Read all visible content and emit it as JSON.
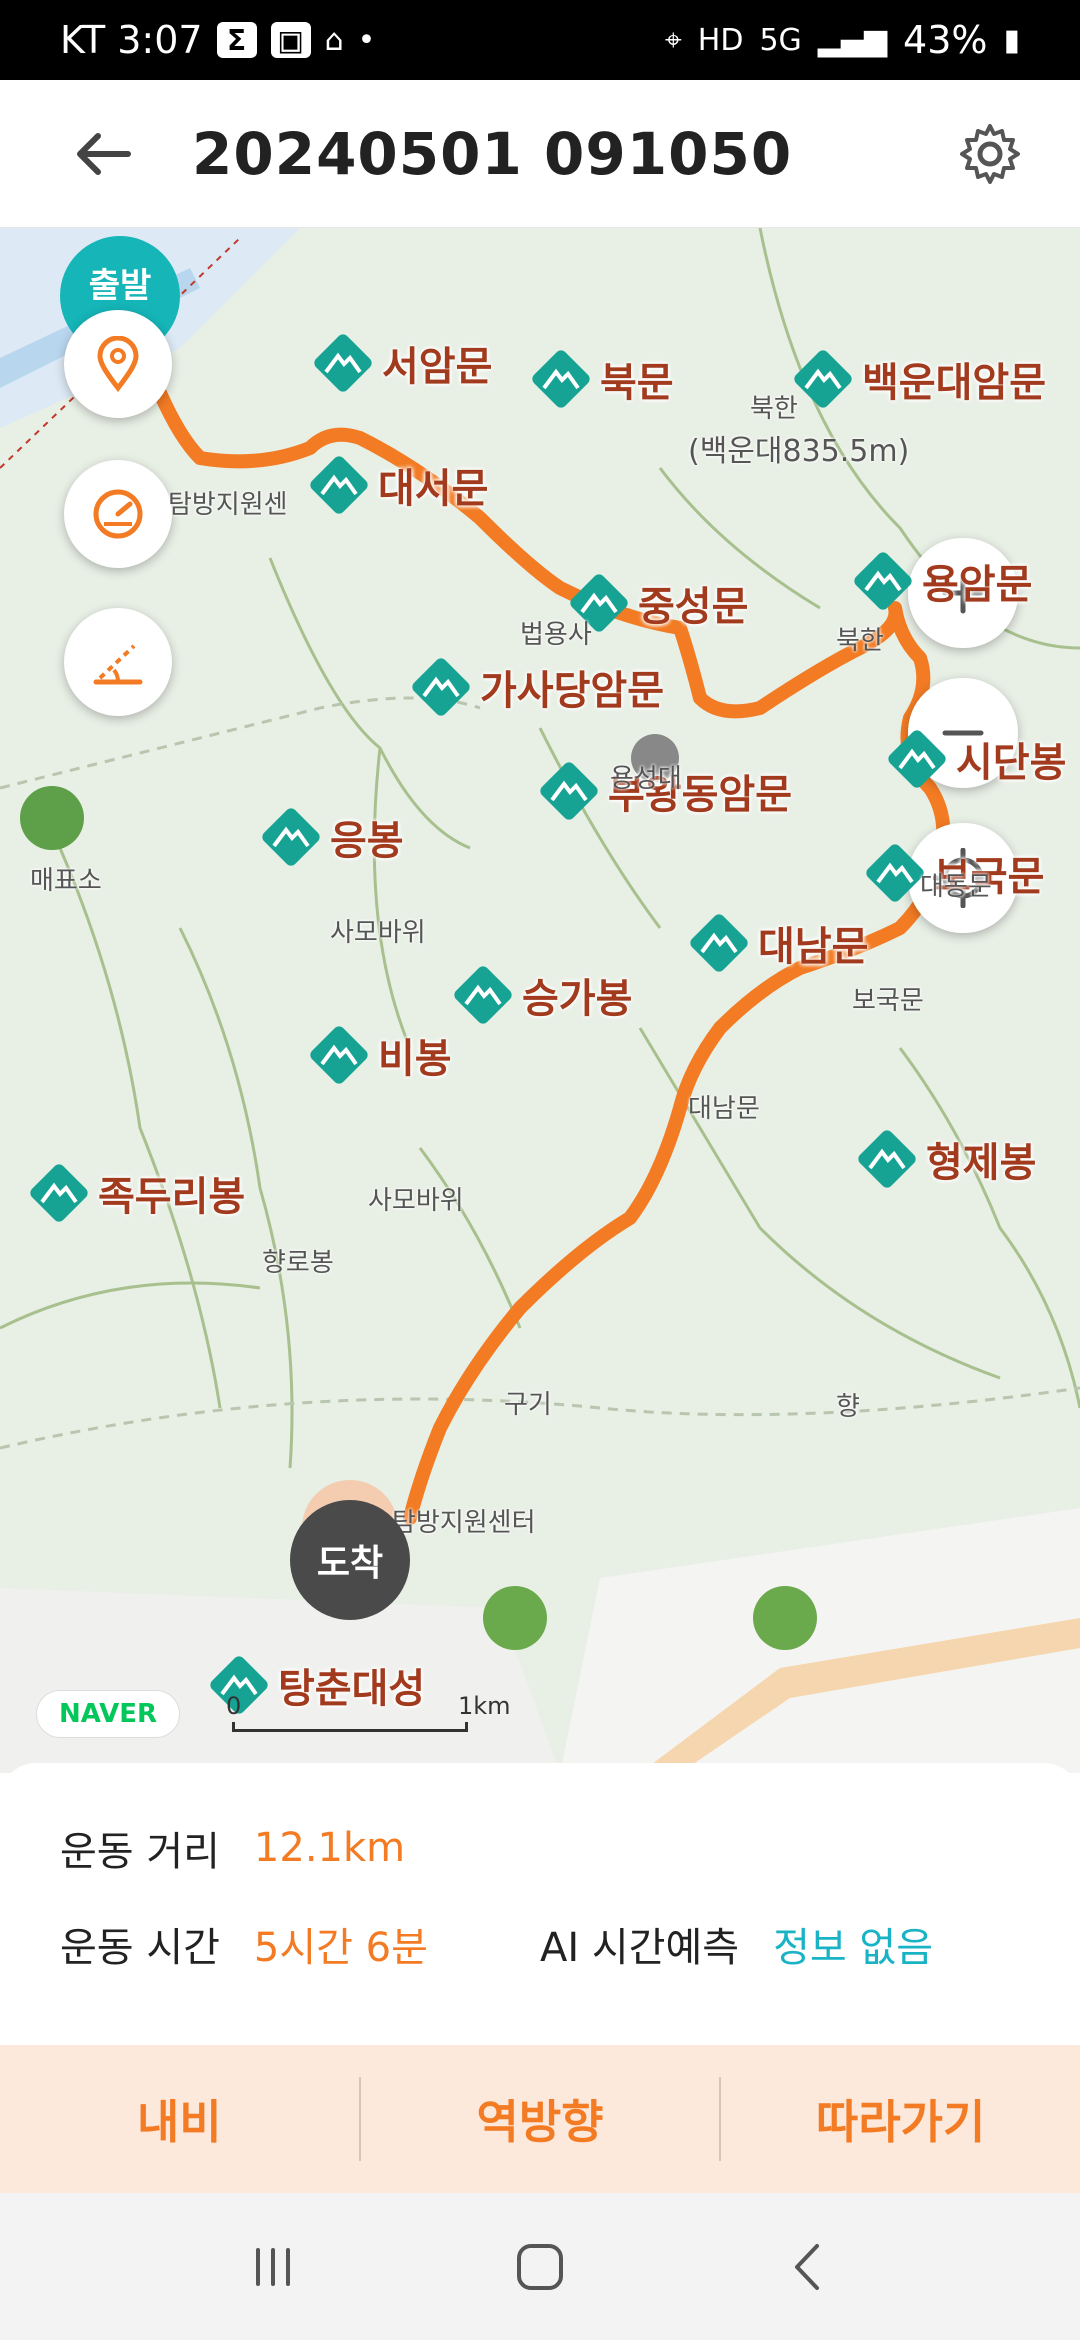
{
  "status_bar": {
    "carrier_time": "KT 3:07",
    "battery": "43%",
    "hd": "HD",
    "network": "5G"
  },
  "header": {
    "title": "20240501 091050"
  },
  "map": {
    "start_badge": "출발",
    "arrive_badge": "도착",
    "provider": "NAVER",
    "scale": {
      "zero": "0",
      "one": "1km"
    },
    "pois": [
      "서암문",
      "북문",
      "백운대암문",
      "대서문",
      "중성문",
      "용암문",
      "가사당암문",
      "시단봉",
      "부왕동암문",
      "응봉",
      "보국문",
      "대남문",
      "승가봉",
      "비봉",
      "형제봉",
      "족두리봉",
      "탕춘대성"
    ],
    "small_labels": [
      "탐방지원센",
      "법용사",
      "북한",
      "(백운대835.5m)",
      "북한",
      "용성대",
      "매표소",
      "사모바위",
      "대동문",
      "보국문",
      "대남문",
      "사모바위",
      "향로봉",
      "구기",
      "향",
      "탐방지원센터"
    ]
  },
  "stats": {
    "distance_label": "운동 거리",
    "distance_value": "12.1km",
    "time_label": "운동 시간",
    "time_value": "5시간 6분",
    "ai_label": "AI 시간예측",
    "ai_value": "정보 없음"
  },
  "actions": {
    "navi": "내비",
    "reverse": "역방향",
    "follow": "따라가기"
  },
  "colors": {
    "accent": "#f27b23",
    "teal": "#1ab3c6",
    "poi_label": "#a23a1d",
    "poi_pin": "#16a394"
  }
}
